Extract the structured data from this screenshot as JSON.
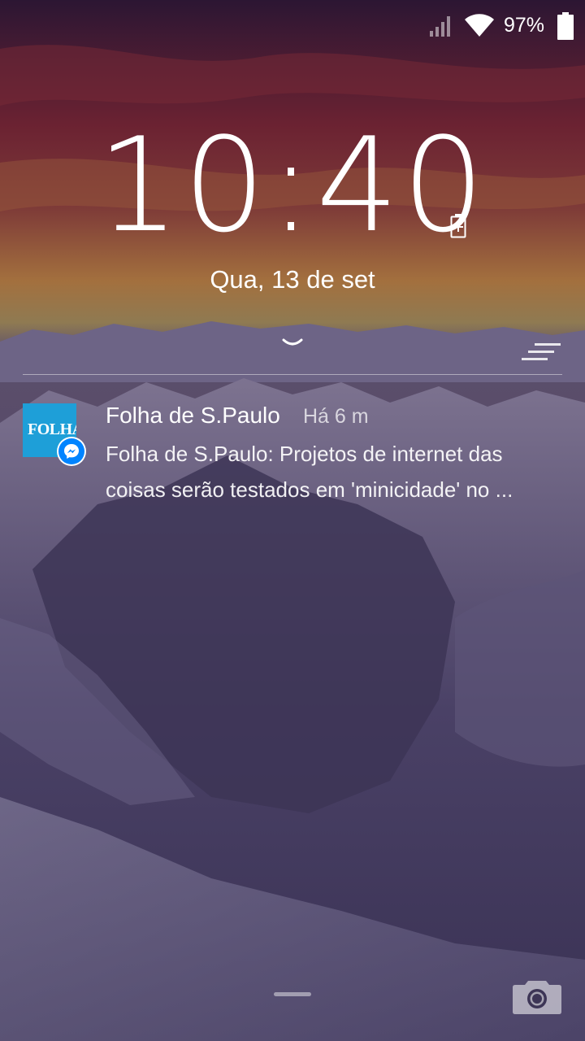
{
  "status_bar": {
    "signal_icon": "cellular-signal-icon",
    "wifi_icon": "wifi-icon",
    "battery_percent": "97%",
    "battery_icon": "battery-icon"
  },
  "lockscreen": {
    "time": "10:40",
    "charging_icon": "battery-charging-icon",
    "date": "Qua, 13 de set",
    "expand_icon": "chevron-down-icon",
    "clear_icon": "clear-all-icon"
  },
  "notification": {
    "app_icon_text": "FOLHA",
    "badge_icon": "messenger-icon",
    "title": "Folha de S.Paulo",
    "time": "Há 6 m",
    "body_line1": "Folha de S.Paulo: Projetos de internet das",
    "body_line2": "coisas serão testados em 'minicidade' no ..."
  },
  "bottom": {
    "handle": "home-handle",
    "camera_icon": "camera-icon"
  },
  "colors": {
    "app_icon_bg": "#1e9fd8",
    "messenger_blue": "#0084ff"
  }
}
